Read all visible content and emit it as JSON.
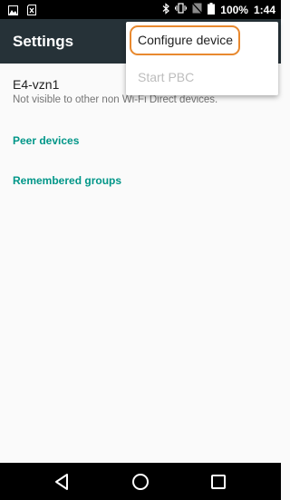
{
  "status_bar": {
    "battery_text": "100%",
    "time": "1:44",
    "icons": [
      "gallery-icon",
      "sd-card-x-icon",
      "bluetooth-icon",
      "vibrate-icon",
      "no-sim-icon",
      "battery-icon"
    ]
  },
  "toolbar": {
    "title": "Settings"
  },
  "device": {
    "name": "E4-vzn1",
    "subtitle": "Not visible to other non Wi-Fi Direct devices."
  },
  "sections": {
    "peer_devices": "Peer devices",
    "remembered_groups": "Remembered groups"
  },
  "menu": {
    "items": [
      {
        "label": "Configure device",
        "enabled": true
      },
      {
        "label": "Start PBC",
        "enabled": false
      }
    ],
    "highlight_color": "#e8892f"
  },
  "nav_bar": {
    "icons": [
      "back-icon",
      "home-icon",
      "recents-icon"
    ]
  },
  "colors": {
    "toolbar": "#263238",
    "section_accent": "#009688",
    "background": "#fafafa"
  }
}
